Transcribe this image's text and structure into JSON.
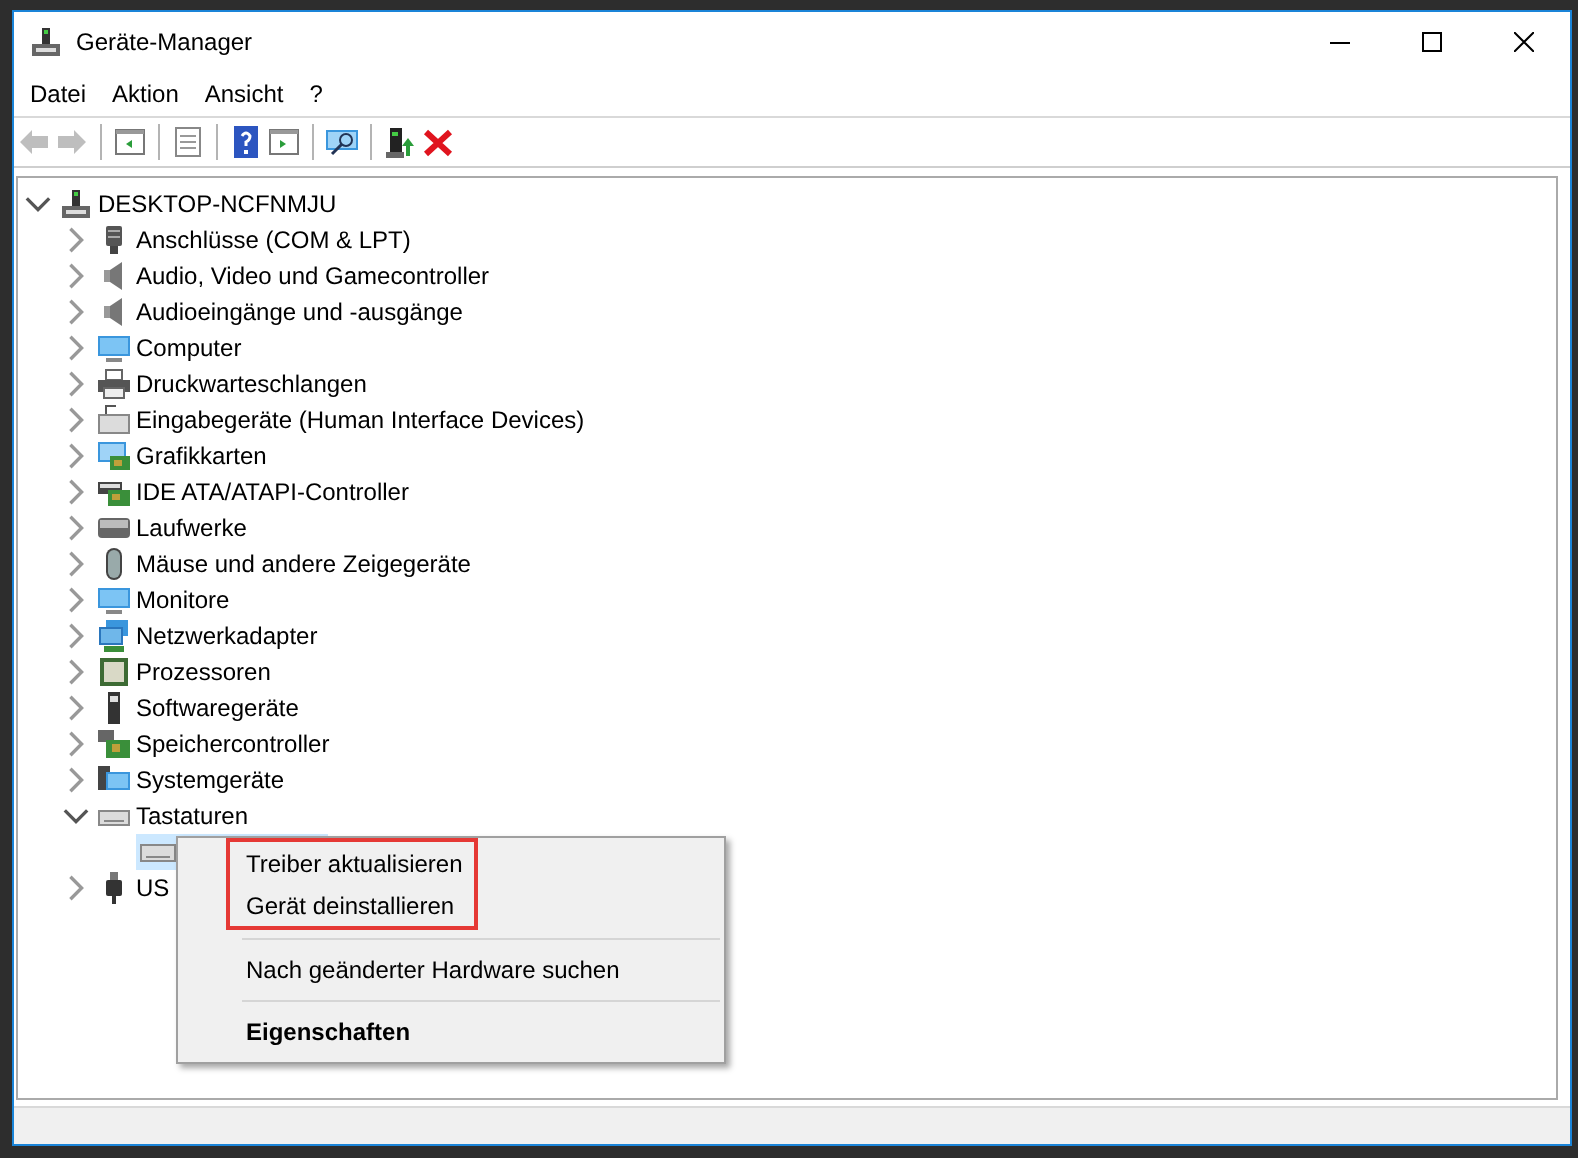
{
  "window": {
    "title": "Geräte-Manager"
  },
  "menu_bar": [
    "Datei",
    "Aktion",
    "Ansicht",
    "?"
  ],
  "toolbar": [
    {
      "disabled": true
    },
    {
      "disabled": true
    },
    {
      "disabled": false
    },
    {
      "disabled": false
    },
    {
      "disabled": false
    },
    {
      "disabled": false
    },
    {
      "disabled": false
    },
    {
      "disabled": false
    },
    {
      "disabled": false
    }
  ],
  "tree": {
    "label": "DESKTOP-NCFNMJU",
    "expanded": true,
    "children": [
      {
        "label": "Anschlüsse (COM & LPT)",
        "expanded": false
      },
      {
        "label": "Audio, Video und Gamecontroller",
        "expanded": false
      },
      {
        "label": "Audioeingänge und -ausgänge",
        "expanded": false
      },
      {
        "label": "Computer",
        "expanded": false
      },
      {
        "label": "Druckwarteschlangen",
        "expanded": false
      },
      {
        "label": "Eingabegeräte (Human Interface Devices)",
        "expanded": false
      },
      {
        "label": "Grafikkarten",
        "expanded": false
      },
      {
        "label": "IDE ATA/ATAPI-Controller",
        "expanded": false
      },
      {
        "label": "Laufwerke",
        "expanded": false
      },
      {
        "label": "Mäuse und andere Zeigegeräte",
        "expanded": false
      },
      {
        "label": "Monitore",
        "expanded": false
      },
      {
        "label": "Netzwerkadapter",
        "expanded": false
      },
      {
        "label": "Prozessoren",
        "expanded": false
      },
      {
        "label": "Softwaregeräte",
        "expanded": false
      },
      {
        "label": "Speichercontroller",
        "expanded": false
      },
      {
        "label": "Systemgeräte",
        "expanded": false
      },
      {
        "label": "Tastaturen",
        "expanded": true,
        "children": [
          {
            "selected": true
          }
        ]
      },
      {
        "label": "US",
        "expanded": false
      }
    ]
  },
  "context_menu": [
    {
      "kind": "item",
      "label": "Treiber aktualisieren",
      "marked": true,
      "bold": false
    },
    {
      "kind": "item",
      "label": "Gerät deinstallieren",
      "marked": true,
      "bold": false
    },
    {
      "kind": "separator"
    },
    {
      "kind": "item",
      "label": "Nach geänderter Hardware suchen",
      "marked": false,
      "bold": false
    },
    {
      "kind": "separator"
    },
    {
      "kind": "item",
      "label": "Eigenschaften",
      "marked": false,
      "bold": true
    }
  ]
}
